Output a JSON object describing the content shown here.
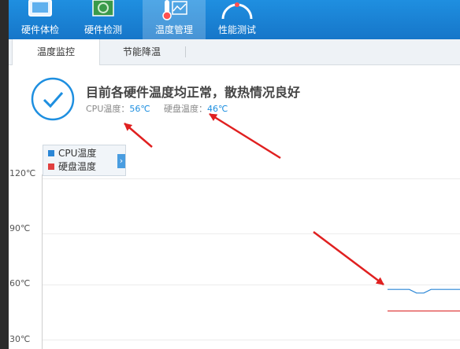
{
  "nav": [
    {
      "label": "硬件体检",
      "icon": "monitor-icon"
    },
    {
      "label": "硬件检测",
      "icon": "chip-icon"
    },
    {
      "label": "温度管理",
      "icon": "thermometer-icon",
      "active": true
    },
    {
      "label": "性能测试",
      "icon": "gauge-icon"
    }
  ],
  "subtabs": [
    {
      "label": "温度监控",
      "active": true
    },
    {
      "label": "节能降温"
    }
  ],
  "status": {
    "headline": "目前各硬件温度均正常，散热情况良好",
    "cpu_label": "CPU温度：",
    "cpu_value": "56℃",
    "disk_label": "硬盘温度：",
    "disk_value": "46℃"
  },
  "legend": {
    "cpu": "CPU温度",
    "disk": "硬盘温度",
    "toggle": "›"
  },
  "colors": {
    "accent": "#1e8fe0",
    "cpu_series": "#2a86d6",
    "disk_series": "#e04040",
    "annotation_arrow": "#e02020"
  },
  "chart_data": {
    "type": "line",
    "yticks": [
      "120℃",
      "90℃",
      "60℃",
      "30℃"
    ],
    "ylim": [
      30,
      120
    ],
    "grid": true,
    "legend_position": "top-left",
    "series": [
      {
        "name": "CPU温度",
        "values": [
          58,
          58,
          58,
          58,
          56,
          56,
          58,
          58,
          58,
          58,
          58
        ],
        "color": "#2a86d6"
      },
      {
        "name": "硬盘温度",
        "values": [
          46,
          46,
          46,
          46,
          46,
          46,
          46,
          46,
          46,
          46,
          46
        ],
        "color": "#e04040"
      }
    ]
  }
}
